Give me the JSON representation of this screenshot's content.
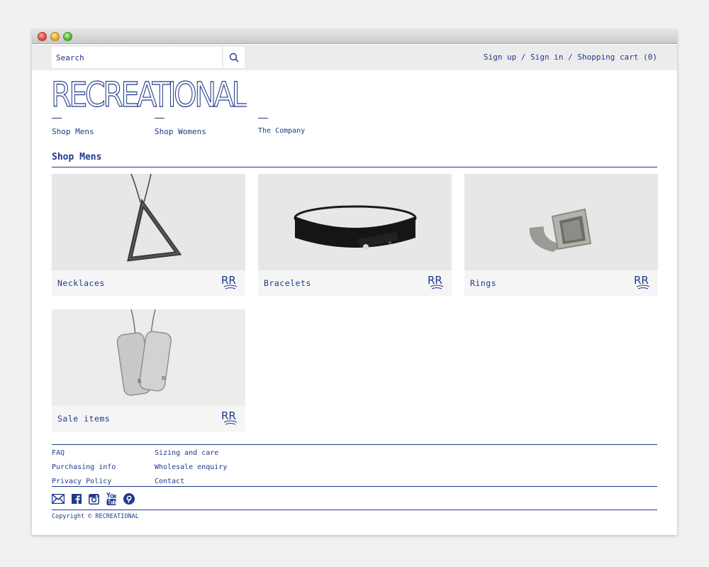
{
  "brand": {
    "name": "RECREATIONAL",
    "accent_color": "#1f3a8a"
  },
  "search": {
    "placeholder": "Search",
    "value": ""
  },
  "account": {
    "links": "Sign up / Sign in / Shopping cart (0)"
  },
  "nav": {
    "items": [
      {
        "label": "Shop Mens"
      },
      {
        "label": "Shop Womens"
      },
      {
        "label": "The Company"
      }
    ]
  },
  "section": {
    "title": "Shop Mens"
  },
  "categories": [
    {
      "label": "Necklaces",
      "icon": "triangle-necklace-image"
    },
    {
      "label": "Bracelets",
      "icon": "leather-bracelet-image"
    },
    {
      "label": "Rings",
      "icon": "signet-ring-image"
    },
    {
      "label": "Sale items",
      "icon": "dog-tags-image"
    }
  ],
  "card_badge": "RR",
  "footer": {
    "col1": [
      "FAQ",
      "Purchasing info",
      "Privacy Policy"
    ],
    "col2": [
      "Sizing and care",
      "Wholesale enquiry",
      "Contact"
    ],
    "social": [
      "mail-icon",
      "facebook-icon",
      "instagram-icon",
      "youtube-icon",
      "pinterest-icon"
    ],
    "copyright": "Copyright © RECREATIONAL"
  }
}
